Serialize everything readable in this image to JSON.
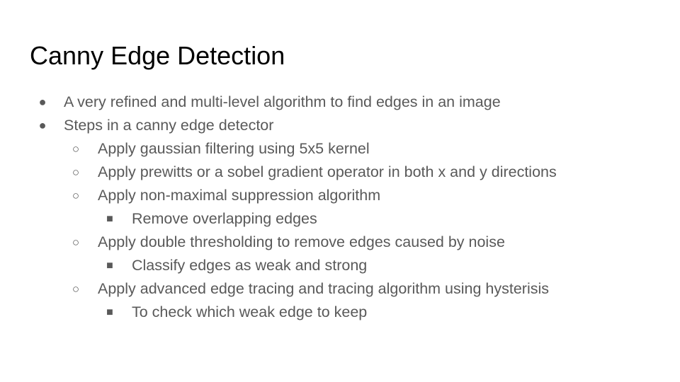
{
  "slide": {
    "title": "Canny Edge Detection",
    "bullets": [
      {
        "marker": "●",
        "text": "A very refined and multi-level algorithm to find edges in an image"
      },
      {
        "marker": "●",
        "text": "Steps in a canny edge detector"
      },
      {
        "marker": "○",
        "text": "Apply gaussian filtering using 5x5 kernel"
      },
      {
        "marker": "○",
        "text": "Apply prewitts or a sobel gradient operator in both x and y directions"
      },
      {
        "marker": "○",
        "text": "Apply non-maximal suppression algorithm"
      },
      {
        "marker": "■",
        "text": "Remove overlapping edges"
      },
      {
        "marker": "○",
        "text": "Apply double thresholding to remove edges caused by noise"
      },
      {
        "marker": "■",
        "text": "Classify edges as weak and strong"
      },
      {
        "marker": "○",
        "text": "Apply advanced edge tracing and tracing algorithm using hysterisis"
      },
      {
        "marker": "■",
        "text": "To check which weak edge to keep"
      }
    ]
  },
  "colors": {
    "title": "#000000",
    "body_text": "#595959",
    "background": "#ffffff"
  }
}
